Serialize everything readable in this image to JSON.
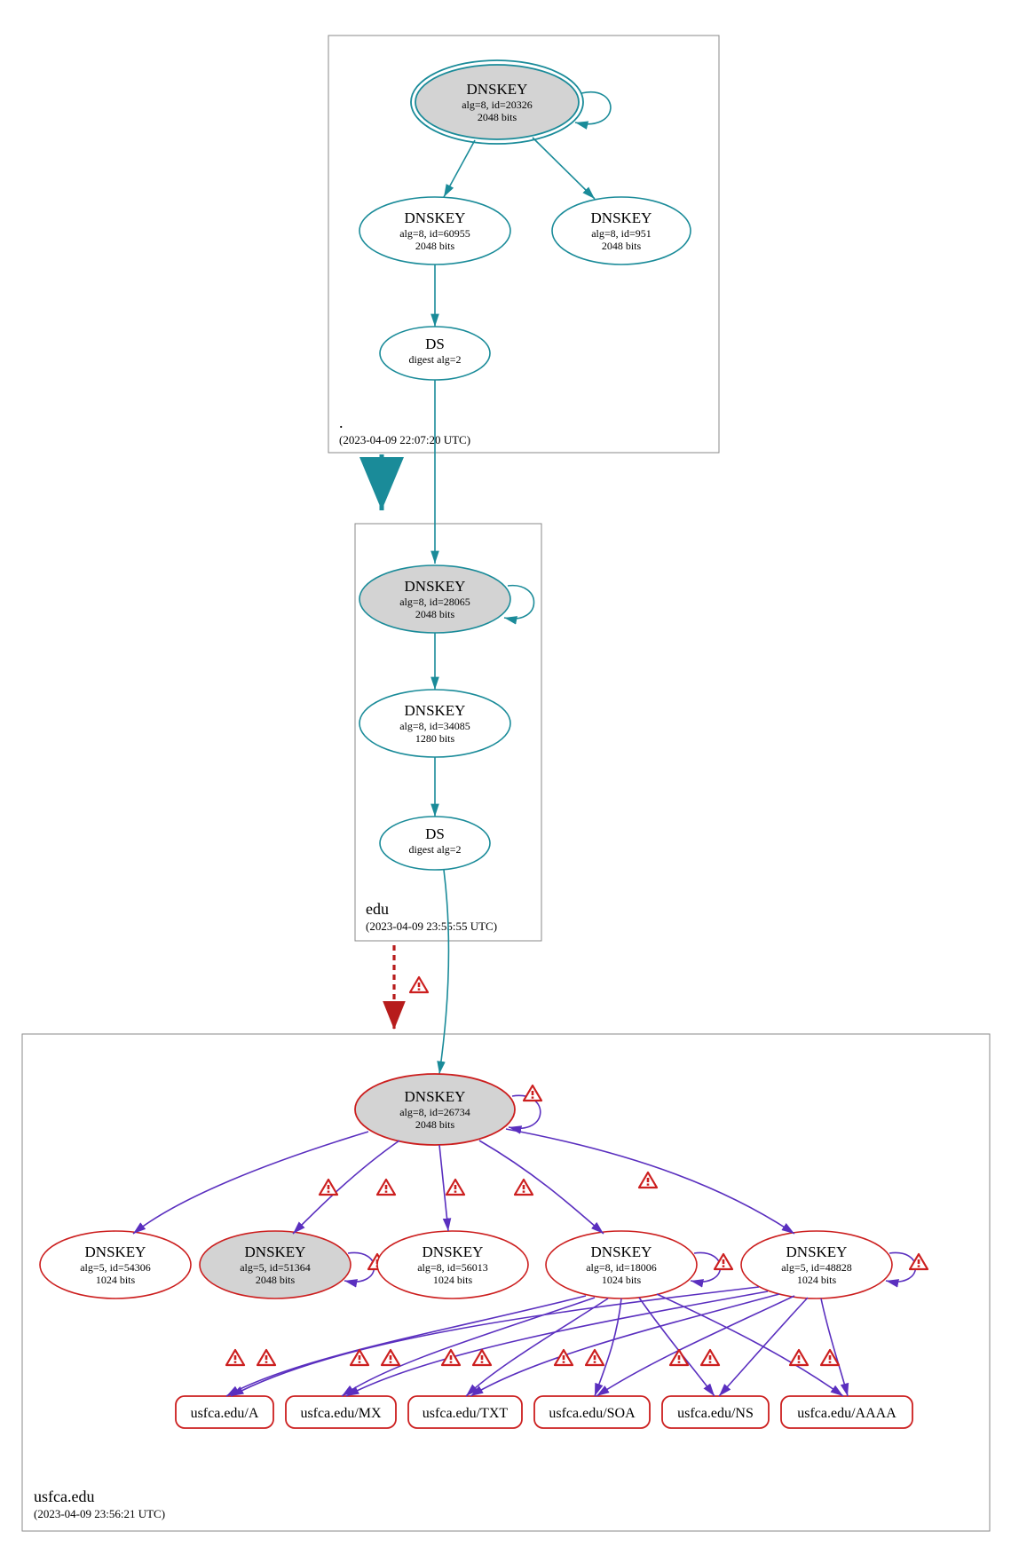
{
  "zones": {
    "root": {
      "name": ".",
      "timestamp": "(2023-04-09 22:07:20 UTC)"
    },
    "edu": {
      "name": "edu",
      "timestamp": "(2023-04-09 23:55:55 UTC)"
    },
    "usfca": {
      "name": "usfca.edu",
      "timestamp": "(2023-04-09 23:56:21 UTC)"
    }
  },
  "nodes": {
    "root_ksk": {
      "title": "DNSKEY",
      "l1": "alg=8, id=20326",
      "l2": "2048 bits"
    },
    "root_zsk1": {
      "title": "DNSKEY",
      "l1": "alg=8, id=60955",
      "l2": "2048 bits"
    },
    "root_zsk2": {
      "title": "DNSKEY",
      "l1": "alg=8, id=951",
      "l2": "2048 bits"
    },
    "root_ds": {
      "title": "DS",
      "l1": "digest alg=2",
      "l2": ""
    },
    "edu_ksk": {
      "title": "DNSKEY",
      "l1": "alg=8, id=28065",
      "l2": "2048 bits"
    },
    "edu_zsk": {
      "title": "DNSKEY",
      "l1": "alg=8, id=34085",
      "l2": "1280 bits"
    },
    "edu_ds": {
      "title": "DS",
      "l1": "digest alg=2",
      "l2": ""
    },
    "u_ksk": {
      "title": "DNSKEY",
      "l1": "alg=8, id=26734",
      "l2": "2048 bits"
    },
    "u_k1": {
      "title": "DNSKEY",
      "l1": "alg=5, id=54306",
      "l2": "1024 bits"
    },
    "u_k2": {
      "title": "DNSKEY",
      "l1": "alg=5, id=51364",
      "l2": "2048 bits"
    },
    "u_k3": {
      "title": "DNSKEY",
      "l1": "alg=8, id=56013",
      "l2": "1024 bits"
    },
    "u_k4": {
      "title": "DNSKEY",
      "l1": "alg=8, id=18006",
      "l2": "1024 bits"
    },
    "u_k5": {
      "title": "DNSKEY",
      "l1": "alg=5, id=48828",
      "l2": "1024 bits"
    }
  },
  "rr": {
    "a": "usfca.edu/A",
    "mx": "usfca.edu/MX",
    "txt": "usfca.edu/TXT",
    "soa": "usfca.edu/SOA",
    "ns": "usfca.edu/NS",
    "aaaa": "usfca.edu/AAAA"
  }
}
